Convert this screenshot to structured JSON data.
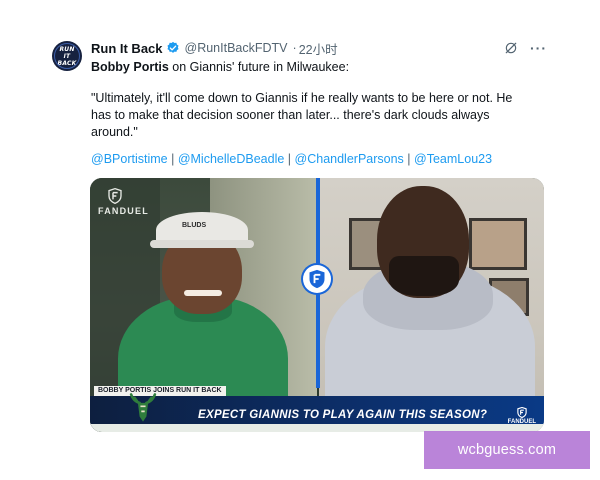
{
  "account": {
    "display_name": "Run It Back",
    "handle": "@RunItBackFDTV",
    "time_ago": "22小时",
    "avatar_line1": "RUN",
    "avatar_line2": "IT",
    "avatar_line3": "BACK"
  },
  "post": {
    "subject_name": "Bobby Portis",
    "subject_rest": " on Giannis' future in Milwaukee:",
    "quote": "\"Ultimately, it'll come down to Giannis if he really wants to be here or not. He has to make that decision sooner than later... there's dark clouds always around.\"",
    "mentions": [
      "@BPortistime",
      "@MichelleDBeadle",
      "@ChandlerParsons",
      "@TeamLou23"
    ],
    "mention_separator": "|"
  },
  "video": {
    "brand": "FANDUEL",
    "hat_text": "BLUDS",
    "lower_third_tag": "BOBBY PORTIS JOINS RUN IT BACK",
    "headline": "EXPECT GIANNIS TO PLAY AGAIN THIS SEASON?",
    "corner_brand": "FANDUEL",
    "accent_color": "#1a66d8"
  },
  "watermark": {
    "text": "wcbguess.com"
  },
  "icons": {
    "verified": "verified-badge-icon",
    "grok": "grok-icon",
    "more": "more-dots-icon"
  }
}
